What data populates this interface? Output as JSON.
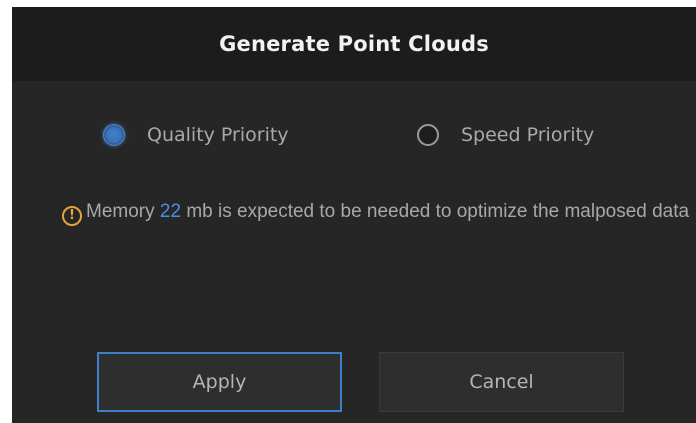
{
  "dialog": {
    "title": "Generate Point Clouds"
  },
  "options": {
    "quality_label": "Quality Priority",
    "speed_label": "Speed Priority",
    "selected": "Quality Priority"
  },
  "info": {
    "icon": "warning-icon",
    "prefix": "Memory ",
    "value": "22",
    "suffix": " mb is expected to be needed to optimize the malposed data"
  },
  "buttons": {
    "apply_label": "Apply",
    "cancel_label": "Cancel"
  },
  "colors": {
    "accent": "#3f7fc9",
    "warning": "#e8a33a",
    "background": "#262626",
    "titlebar": "#1c1c1c"
  }
}
